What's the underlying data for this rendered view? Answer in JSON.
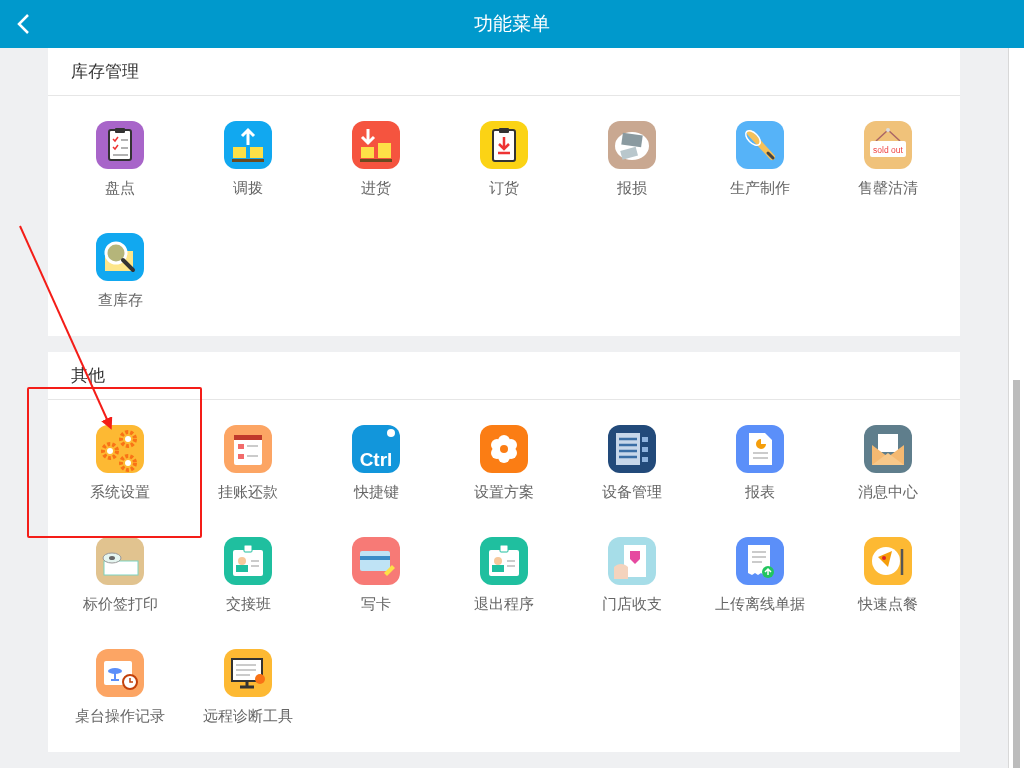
{
  "header": {
    "title": "功能菜单"
  },
  "sections": [
    {
      "title": "库存管理",
      "items": [
        {
          "label": "盘点"
        },
        {
          "label": "调拨"
        },
        {
          "label": "进货"
        },
        {
          "label": "订货"
        },
        {
          "label": "报损"
        },
        {
          "label": "生产制作"
        },
        {
          "label": "售罄沽清",
          "icon_text": "sold out"
        },
        {
          "label": "查库存"
        }
      ]
    },
    {
      "title": "其他",
      "items": [
        {
          "label": "系统设置"
        },
        {
          "label": "挂账还款"
        },
        {
          "label": "快捷键",
          "icon_text": "Ctrl"
        },
        {
          "label": "设置方案"
        },
        {
          "label": "设备管理"
        },
        {
          "label": "报表"
        },
        {
          "label": "消息中心"
        },
        {
          "label": "标价签打印"
        },
        {
          "label": "交接班"
        },
        {
          "label": "写卡"
        },
        {
          "label": "退出程序"
        },
        {
          "label": "门店收支"
        },
        {
          "label": "上传离线单据"
        },
        {
          "label": "快速点餐"
        },
        {
          "label": "桌台操作记录"
        },
        {
          "label": "远程诊断工具"
        }
      ]
    }
  ]
}
